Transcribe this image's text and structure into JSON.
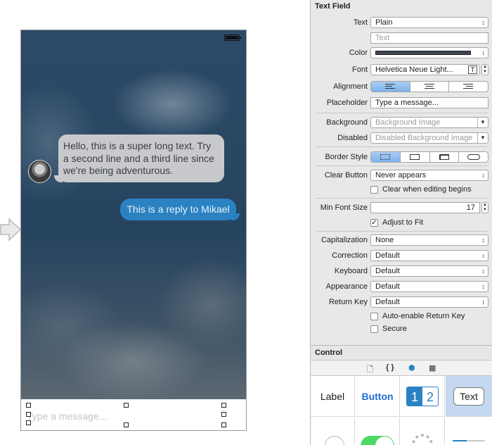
{
  "canvas": {
    "bubbles": {
      "incoming": "Hello, this is a super long text. Try a second line and a third line since we're being adventurous.",
      "outgoing": "This is a reply to Mikael"
    },
    "input_placeholder": "Type a message..."
  },
  "inspector": {
    "section_title": "Text Field",
    "rows": {
      "text": {
        "label": "Text",
        "value": "Plain",
        "field_placeholder": "Text"
      },
      "color": {
        "label": "Color",
        "swatch": "#3c4552"
      },
      "font": {
        "label": "Font",
        "value": "Helvetica Neue Light..."
      },
      "alignment": {
        "label": "Alignment",
        "selected": "left"
      },
      "placeholder": {
        "label": "Placeholder",
        "value": "Type a message..."
      },
      "background": {
        "label": "Background",
        "placeholder": "Background Image"
      },
      "disabled": {
        "label": "Disabled",
        "placeholder": "Disabled Background Image"
      },
      "border_style": {
        "label": "Border Style",
        "selected": "none"
      },
      "clear_button": {
        "label": "Clear Button",
        "value": "Never appears"
      },
      "clear_when_editing": {
        "label": "Clear when editing begins",
        "checked": false
      },
      "min_font_size": {
        "label": "Min Font Size",
        "value": "17"
      },
      "adjust_to_fit": {
        "label": "Adjust to Fit",
        "checked": true
      },
      "capitalization": {
        "label": "Capitalization",
        "value": "None"
      },
      "correction": {
        "label": "Correction",
        "value": "Default"
      },
      "keyboard": {
        "label": "Keyboard",
        "value": "Default"
      },
      "appearance": {
        "label": "Appearance",
        "value": "Default"
      },
      "return_key": {
        "label": "Return Key",
        "value": "Default"
      },
      "auto_enable_return": {
        "label": "Auto-enable Return Key",
        "checked": false
      },
      "secure": {
        "label": "Secure",
        "checked": false
      }
    },
    "control_section_title": "Control",
    "library": {
      "label_item": "Label",
      "button_item": "Button",
      "segment_1": "1",
      "segment_2": "2",
      "text_item": "Text"
    },
    "colors": {
      "accent": "#2a82c2",
      "selection": "#c4d9f1"
    }
  }
}
